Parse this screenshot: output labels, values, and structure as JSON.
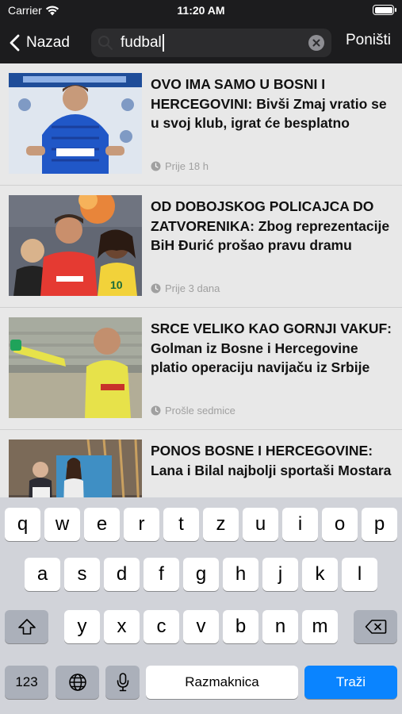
{
  "status": {
    "carrier": "Carrier",
    "time": "11:20 AM"
  },
  "header": {
    "back_label": "Nazad",
    "search_value": "fudbal",
    "cancel_label": "Poništi"
  },
  "articles": [
    {
      "title": "OVO IMA SAMO U BOSNI I HERCEGOVINI: Bivši Zmaj vratio se u svoj klub, igrat će besplatno",
      "time": "Prije 18 h"
    },
    {
      "title": "OD DOBOJSKOG POLICAJCA DO ZATVORENIKA: Zbog reprezentacije BiH Đurić prošao pravu dramu",
      "time": "Prije 3 dana"
    },
    {
      "title": "SRCE VELIKO KAO GORNJI VAKUF: Golman iz Bosne i Hercegovine platio operaciju navijaču iz Srbije",
      "time": "Prošle sedmice"
    },
    {
      "title": "PONOS BOSNE I HERCEGOVINE: Lana i Bilal najbolji sportaši Mostara",
      "time": ""
    }
  ],
  "keyboard": {
    "row1": [
      "q",
      "w",
      "e",
      "r",
      "t",
      "z",
      "u",
      "i",
      "o",
      "p"
    ],
    "row2": [
      "a",
      "s",
      "d",
      "f",
      "g",
      "h",
      "j",
      "k",
      "l"
    ],
    "row3": [
      "y",
      "x",
      "c",
      "v",
      "b",
      "n",
      "m"
    ],
    "numbers_label": "123",
    "space_label": "Razmaknica",
    "go_label": "Traži"
  }
}
